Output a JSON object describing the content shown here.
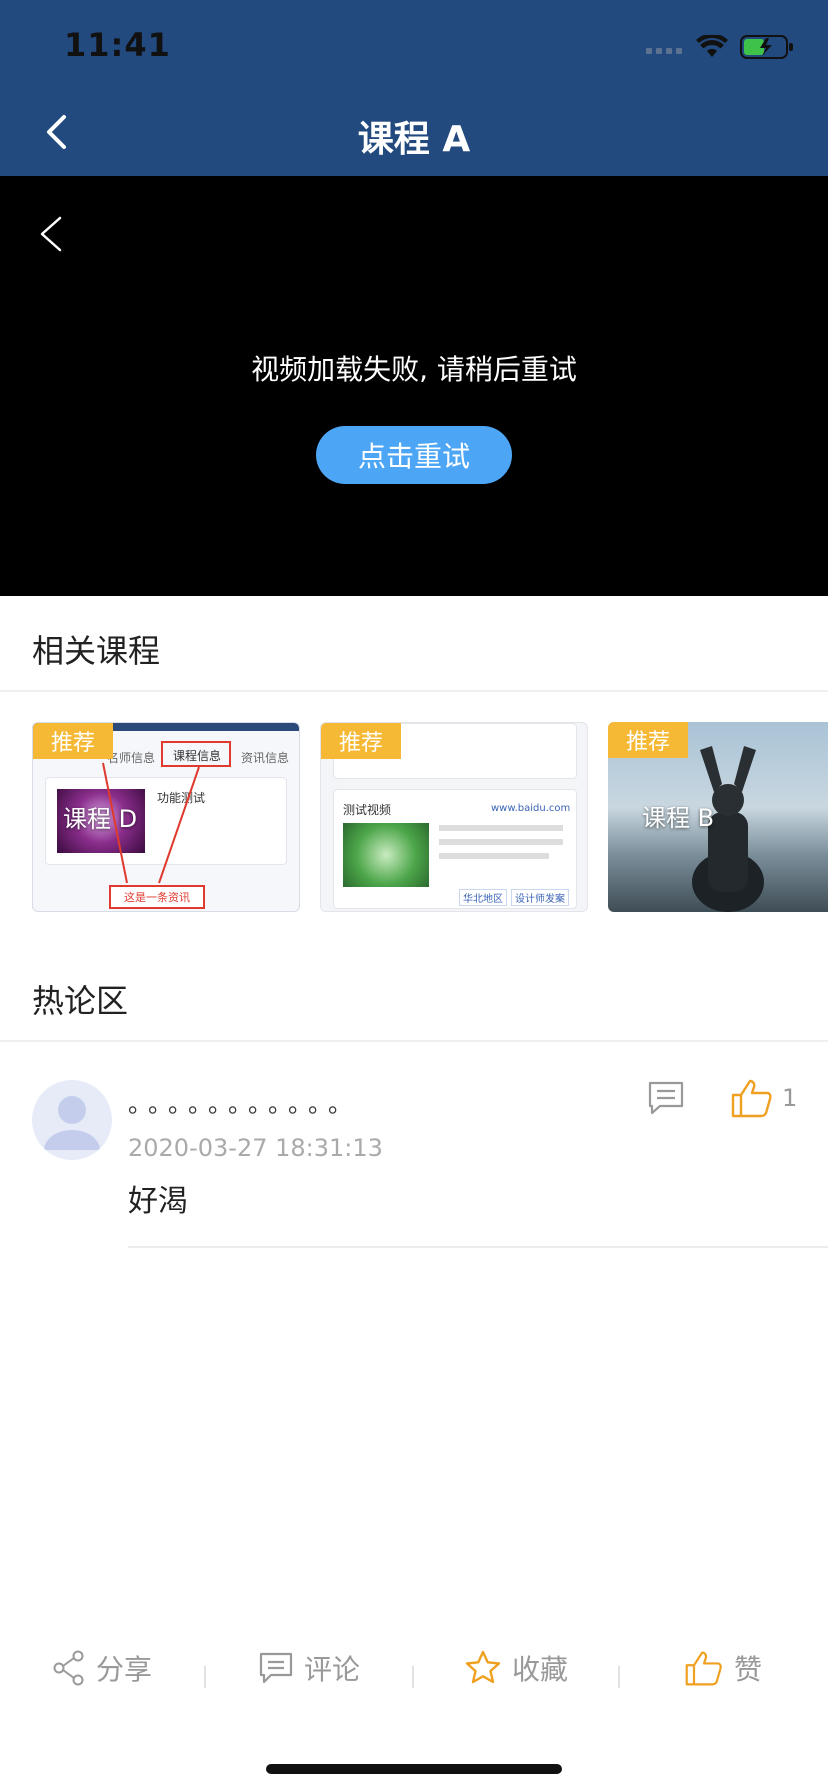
{
  "status_bar": {
    "time": "11:41"
  },
  "nav": {
    "title": "课程 A"
  },
  "video": {
    "error_message": "视频加载失败, 请稍后重试",
    "retry_label": "点击重试"
  },
  "related": {
    "title": "相关课程",
    "cards": [
      {
        "badge": "推荐",
        "label": "课程 D",
        "screenshot_text": {
          "tab_1": "名师信息",
          "tab_2": "课程信息",
          "tab_3": "资讯信息",
          "course": "功能测试",
          "footer": "这是一条资讯"
        }
      },
      {
        "badge": "推荐",
        "label": "",
        "screenshot_text": {
          "site": "www.baidu.com",
          "title": "测试视频",
          "tag_1": "华北地区",
          "tag_2": "设计师发案"
        }
      },
      {
        "badge": "推荐",
        "label": "课程 B"
      }
    ]
  },
  "discussion": {
    "title": "热论区",
    "comments": [
      {
        "name": "。。。。。。。。。。。",
        "time": "2020-03-27 18:31:13",
        "text": "好渴",
        "likes": "1"
      }
    ]
  },
  "bottom_bar": {
    "share": "分享",
    "comment": "评论",
    "favorite": "收藏",
    "like": "赞"
  },
  "colors": {
    "nav_bg": "#224a7f",
    "retry_btn": "#4da6f5",
    "badge": "#f5b935",
    "like_icon": "#f0a020"
  }
}
